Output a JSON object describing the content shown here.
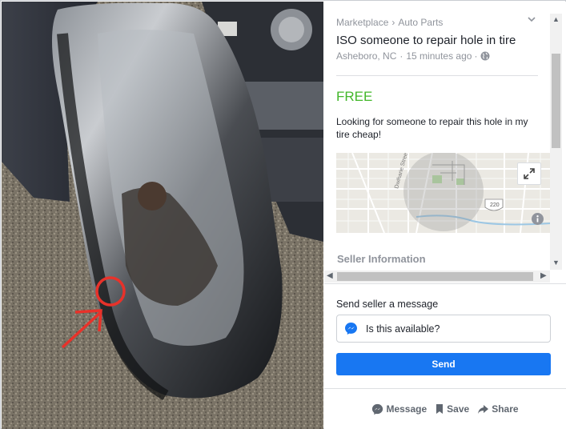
{
  "listing": {
    "breadcrumb": [
      "Marketplace",
      "Auto Parts"
    ],
    "breadcrumb_separator": "›",
    "title": "ISO someone to repair hole in tire",
    "location": "Asheboro, NC",
    "posted": "15 minutes ago",
    "meta_separator": "·",
    "price": "FREE",
    "description": "Looking for someone to repair this hole in my tire cheap!",
    "collapse_icon": "chevron-down-icon",
    "visibility_icon": "globe-icon",
    "price_color": "#42b72a"
  },
  "map": {
    "street_label": "Dwiharie Street",
    "route_shield": "220",
    "expand_icon": "expand-icon",
    "info_icon": "info-icon"
  },
  "seller": {
    "heading": "Seller Information"
  },
  "message": {
    "heading": "Send seller a message",
    "input_value": "Is this available?",
    "send_label": "Send",
    "messenger_icon": "messenger-icon",
    "send_color": "#1877f2"
  },
  "actions": [
    {
      "label": "Message",
      "icon": "messenger-icon"
    },
    {
      "label": "Save",
      "icon": "bookmark-icon"
    },
    {
      "label": "Share",
      "icon": "share-arrow-icon"
    }
  ],
  "scrollbars": {
    "up": "▲",
    "down": "▼",
    "left": "◀",
    "right": "▶"
  }
}
